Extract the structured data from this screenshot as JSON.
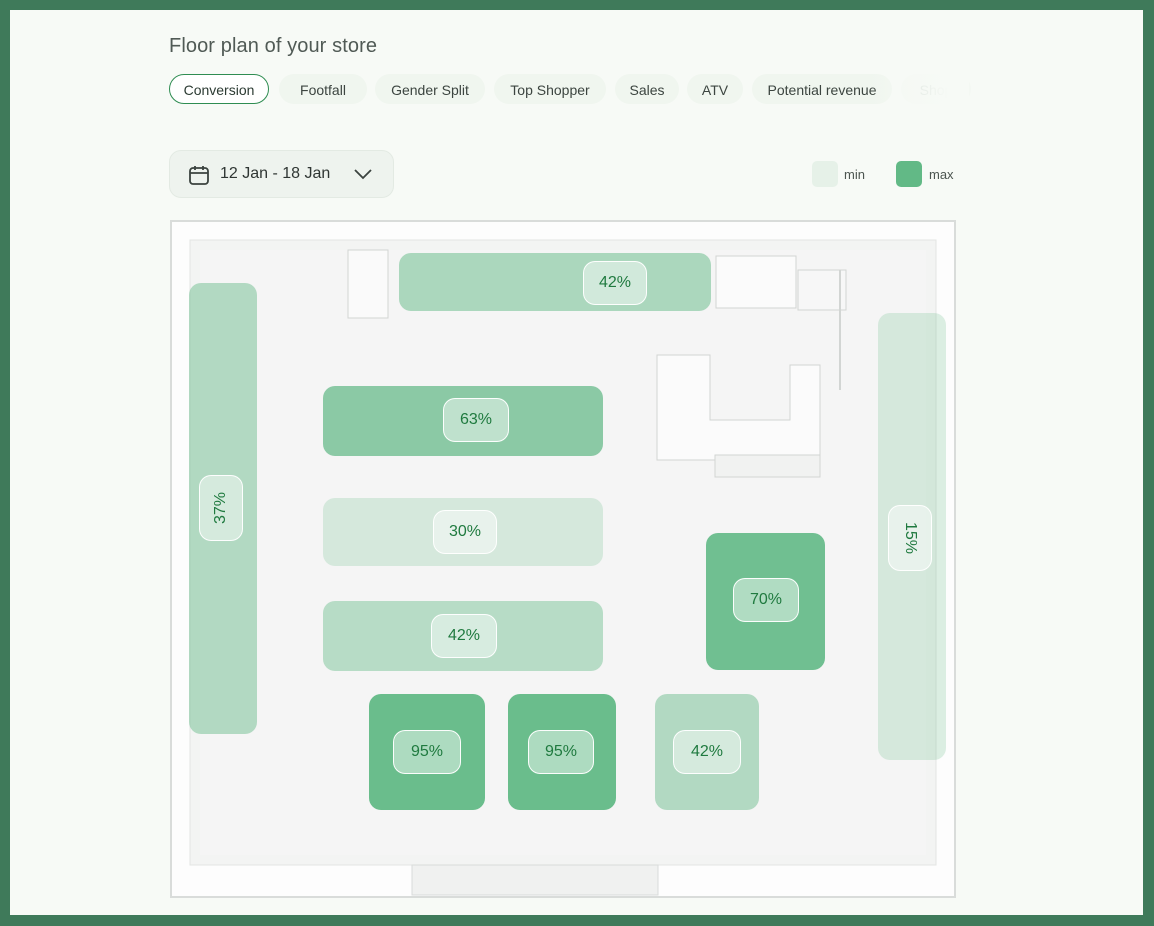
{
  "header": {
    "title": "Floor plan of your store"
  },
  "tabs": [
    {
      "label": "Conversion",
      "active": true
    },
    {
      "label": "Footfall"
    },
    {
      "label": "Gender Split"
    },
    {
      "label": "Top Shopper"
    },
    {
      "label": "Sales"
    },
    {
      "label": "ATV"
    },
    {
      "label": "Potential revenue"
    },
    {
      "label": "Shop"
    }
  ],
  "date_range": {
    "label": "12 Jan - 18 Jan",
    "icon": "calendar-icon",
    "chevron": "chevron-down-icon"
  },
  "legend": {
    "min": {
      "label": "min",
      "color": "#e6f1e8"
    },
    "max": {
      "label": "max",
      "color": "#62b986"
    }
  },
  "zones": [
    {
      "name": "zone-back-wall-shelf",
      "value": "42%",
      "intensity": 0.42
    },
    {
      "name": "zone-left-wall-fridge",
      "value": "37%",
      "intensity": 0.37
    },
    {
      "name": "zone-aisle-1",
      "value": "63%",
      "intensity": 0.63
    },
    {
      "name": "zone-aisle-2",
      "value": "30%",
      "intensity": 0.3
    },
    {
      "name": "zone-aisle-3",
      "value": "42%",
      "intensity": 0.42
    },
    {
      "name": "zone-produce-right",
      "value": "70%",
      "intensity": 0.7
    },
    {
      "name": "zone-right-wall-fridge",
      "value": "15%",
      "intensity": 0.15
    },
    {
      "name": "zone-produce-bin-1",
      "value": "95%",
      "intensity": 0.95
    },
    {
      "name": "zone-produce-bin-2",
      "value": "95%",
      "intensity": 0.95
    },
    {
      "name": "zone-produce-bin-3",
      "value": "42%",
      "intensity": 0.42
    }
  ]
}
